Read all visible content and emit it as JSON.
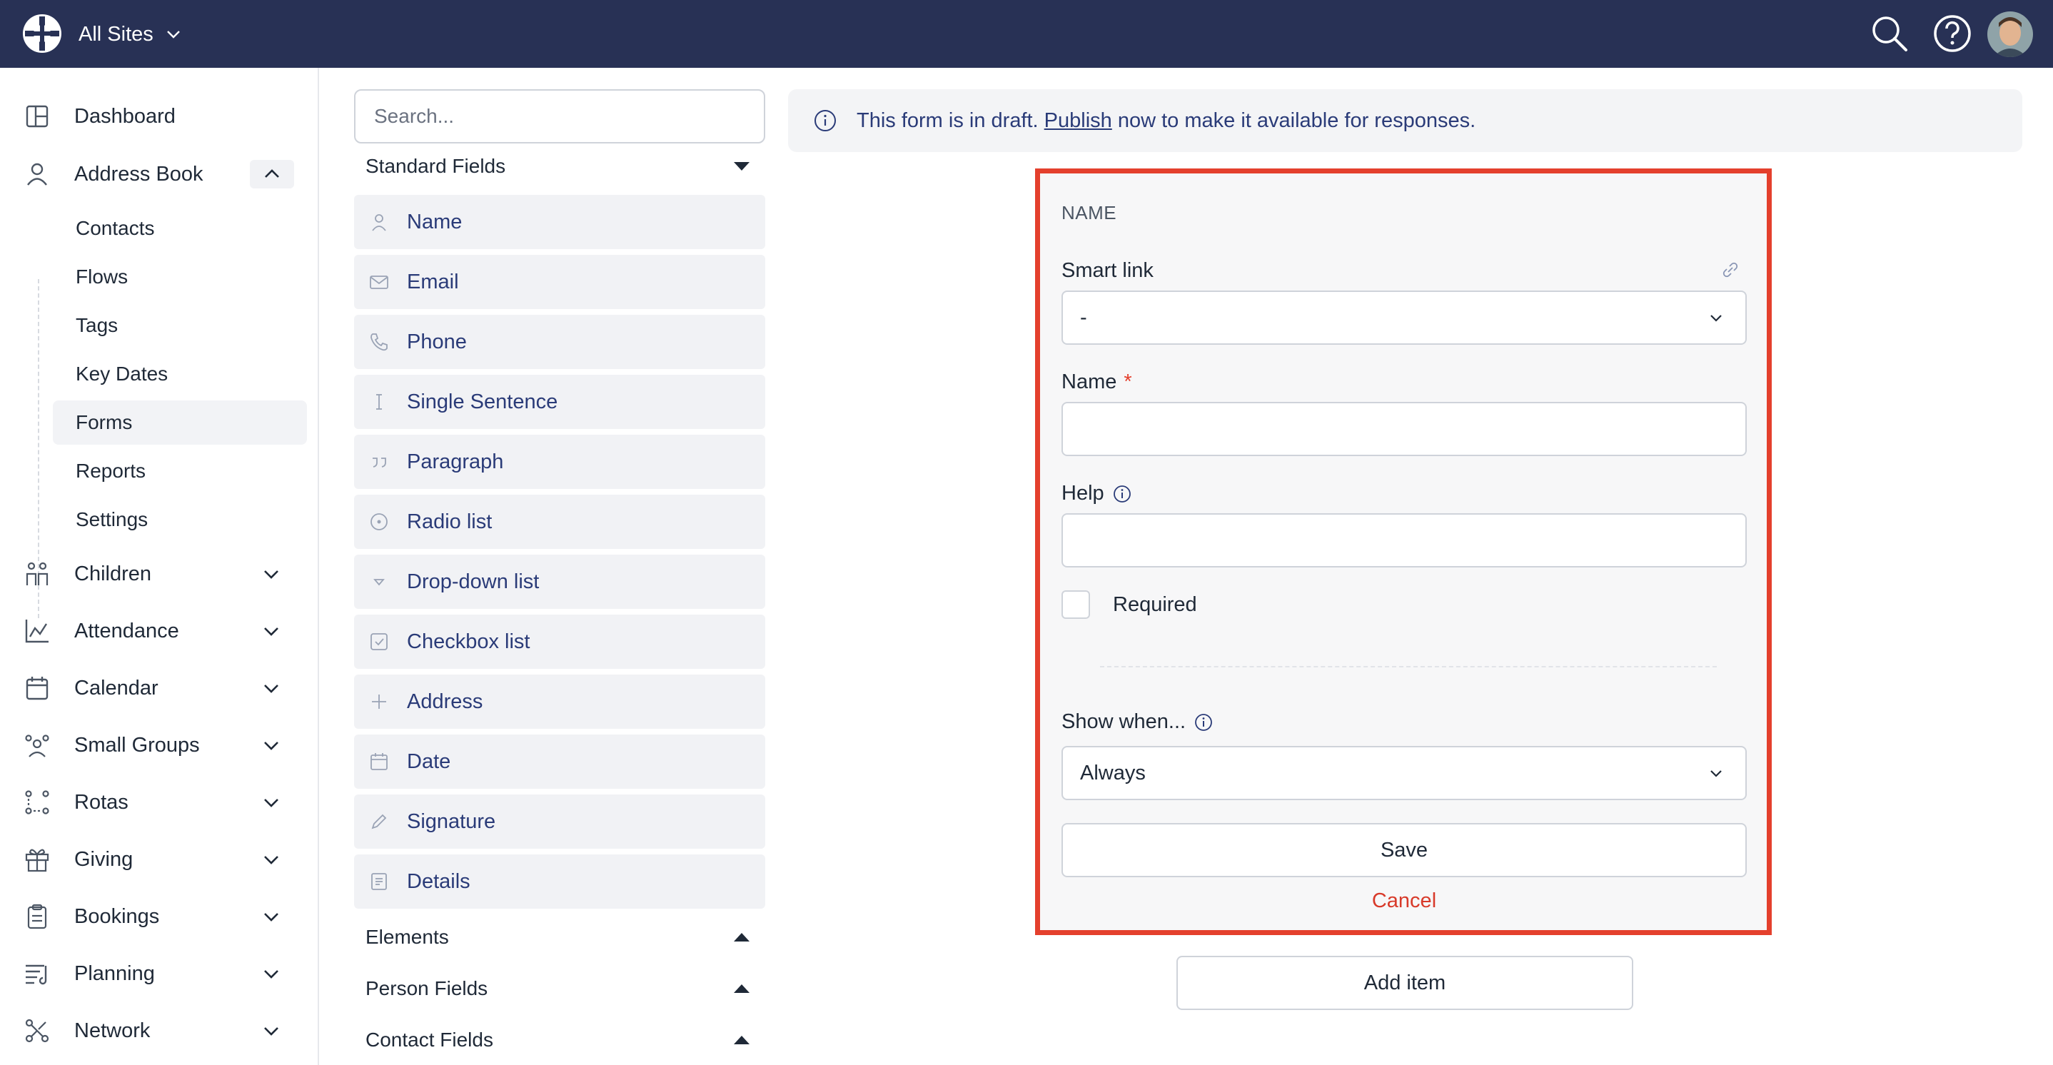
{
  "topbar": {
    "site_switcher": "All Sites",
    "icons": [
      "logo-icon",
      "chevron-down-icon",
      "search-icon",
      "help-icon",
      "avatar"
    ]
  },
  "sidebar": {
    "items": [
      {
        "label": "Dashboard",
        "icon": "dashboard-icon"
      },
      {
        "label": "Address Book",
        "icon": "person-icon",
        "expanded": true
      },
      {
        "label": "Children",
        "icon": "children-icon"
      },
      {
        "label": "Attendance",
        "icon": "attendance-chart-icon"
      },
      {
        "label": "Calendar",
        "icon": "calendar-icon"
      },
      {
        "label": "Small Groups",
        "icon": "small-groups-icon"
      },
      {
        "label": "Rotas",
        "icon": "rotas-icon"
      },
      {
        "label": "Giving",
        "icon": "gift-icon"
      },
      {
        "label": "Bookings",
        "icon": "clipboard-icon"
      },
      {
        "label": "Planning",
        "icon": "planning-icon"
      },
      {
        "label": "Network",
        "icon": "network-icon"
      }
    ],
    "address_book_sub": [
      {
        "label": "Contacts"
      },
      {
        "label": "Flows"
      },
      {
        "label": "Tags"
      },
      {
        "label": "Key Dates"
      },
      {
        "label": "Forms",
        "active": true
      },
      {
        "label": "Reports"
      },
      {
        "label": "Settings"
      }
    ]
  },
  "palette": {
    "search_placeholder": "Search...",
    "standard_heading": "Standard Fields",
    "fields": [
      {
        "label": "Name",
        "icon": "person-icon"
      },
      {
        "label": "Email",
        "icon": "envelope-icon"
      },
      {
        "label": "Phone",
        "icon": "phone-icon"
      },
      {
        "label": "Single Sentence",
        "icon": "text-cursor-icon"
      },
      {
        "label": "Paragraph",
        "icon": "quote-icon"
      },
      {
        "label": "Radio list",
        "icon": "radio-icon"
      },
      {
        "label": "Drop-down list",
        "icon": "dropdown-triangle-icon"
      },
      {
        "label": "Checkbox list",
        "icon": "checkbox-icon"
      },
      {
        "label": "Address",
        "icon": "plus-icon"
      },
      {
        "label": "Date",
        "icon": "calendar-icon"
      },
      {
        "label": "Signature",
        "icon": "pencil-icon"
      },
      {
        "label": "Details",
        "icon": "details-icon"
      }
    ],
    "sections": [
      {
        "label": "Elements"
      },
      {
        "label": "Person Fields"
      },
      {
        "label": "Contact Fields"
      }
    ]
  },
  "banner": {
    "text_before": "This form is in draft. ",
    "link": "Publish",
    "text_after": " now to make it available for responses."
  },
  "editor": {
    "section_title": "NAME",
    "smart_link_label": "Smart link",
    "smart_link_value": "-",
    "name_label": "Name",
    "required_star": "*",
    "help_label": "Help",
    "required_label": "Required",
    "required_checked": false,
    "show_when_label": "Show when...",
    "show_when_value": "Always",
    "save_label": "Save",
    "cancel_label": "Cancel"
  },
  "add_item_label": "Add item",
  "colors": {
    "topbar": "#283155",
    "highlight_border": "#e4402d",
    "field_text": "#2a3b78",
    "cancel": "#d83a2a"
  }
}
